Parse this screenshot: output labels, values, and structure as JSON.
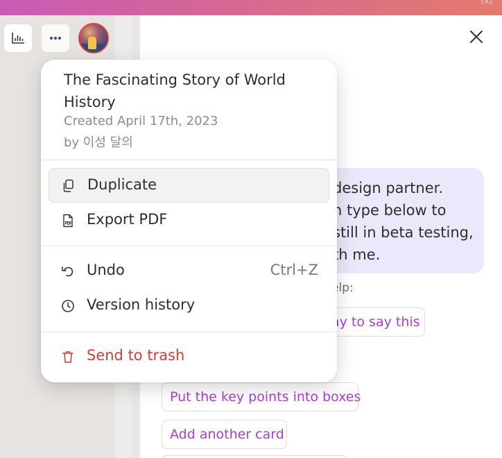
{
  "window": {
    "corner_glyph": "(x)"
  },
  "toolbar": {
    "analytics_icon": "bar-chart-icon",
    "more_icon": "more-dots-icon",
    "avatar_alt": "user avatar"
  },
  "chat": {
    "lines": [
      "design partner.",
      "n type below to",
      "still in beta testing,",
      "th me."
    ],
    "help_label": "elp:",
    "suggestions": [
      "ay to say this",
      "Put the key points into boxes",
      "Add another card"
    ]
  },
  "menu": {
    "title": "The Fascinating Story of World History",
    "created": "Created April 17th, 2023",
    "by": "by 이성 달의",
    "items": [
      {
        "label": "Duplicate",
        "icon": "duplicate-icon",
        "active": true
      },
      {
        "label": "Export PDF",
        "icon": "pdf-icon"
      },
      {
        "label": "Undo",
        "icon": "undo-icon",
        "shortcut": "Ctrl+Z"
      },
      {
        "label": "Version history",
        "icon": "clock-icon"
      },
      {
        "label": "Send to trash",
        "icon": "trash-icon",
        "danger": true
      }
    ]
  },
  "colors": {
    "accent": "#a83ed6",
    "danger": "#d93a36",
    "bubble": "#ece8fb",
    "menu_active": "#f3f2f1"
  }
}
